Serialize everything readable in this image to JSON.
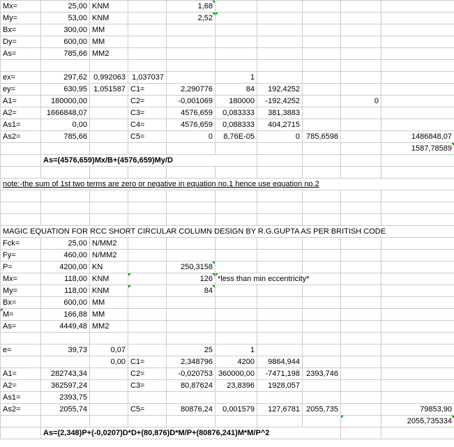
{
  "r1": {
    "a": "Mx=",
    "b": "25,00",
    "c": "KNM",
    "e": "1,68"
  },
  "r2": {
    "a": "My=",
    "b": "53,00",
    "c": "KNM",
    "e": "2,52"
  },
  "r3": {
    "a": "Bx=",
    "b": "300,00",
    "c": "MM"
  },
  "r4": {
    "a": "Dy=",
    "b": "600,00",
    "c": "MM"
  },
  "r5": {
    "a": "As=",
    "b": "785,66",
    "c": "MM2"
  },
  "r7": {
    "a": "ex=",
    "b": "297,62",
    "c": "0,992063",
    "d": "1,037037",
    "f": "1"
  },
  "r8": {
    "a": "ey=",
    "b": "630,95",
    "c": "1,051587",
    "d": "C1=",
    "e": "2,290776",
    "f": "84",
    "g": "192,4252"
  },
  "r9": {
    "a": "A1=",
    "b": "180000,00",
    "d": "C2=",
    "e": "-0,001069",
    "f": "180000",
    "g": "-192,4252",
    "i": "0"
  },
  "r10": {
    "a": "A2=",
    "b": "1666848,07",
    "d": "C3=",
    "e": "4576,659",
    "f": "0,083333",
    "g": "381,3883"
  },
  "r11": {
    "a": "As1=",
    "b": "0,00",
    "d": "C4=",
    "e": "4576,659",
    "f": "0,088333",
    "g": "404,2715"
  },
  "r12": {
    "a": "As2=",
    "b": "785,66",
    "d": "C5=",
    "e": "0",
    "f": "8,76E-05",
    "g": "0",
    "h": "785,6598",
    "j": "1486848,07"
  },
  "r13": {
    "j": "1587,78589"
  },
  "r14": {
    "formula": "As=(4576,659)Mx/B+(4576,659)My/D"
  },
  "r16": {
    "note": "note:-the sum of 1st two terms are zero or negative in equation no.1 hence use equation no.2"
  },
  "r20": {
    "title": "MAGIC EQUATION FOR RCC SHORT CIRCULAR COLUMN DESIGN BY R.G.GUPTA AS PER BRITISH CODE"
  },
  "r21": {
    "a": "Fck=",
    "b": "25,00",
    "c": "N/MM2"
  },
  "r22": {
    "a": "Fy=",
    "b": "460,00",
    "c": "N/MM2"
  },
  "r23": {
    "a": "P=",
    "b": "4200,00",
    "c": "KN",
    "e": "250,3158"
  },
  "r24": {
    "a": "Mx=",
    "b": "118,00",
    "c": "KNM",
    "e": "126",
    "f": "*less than min eccentricity*"
  },
  "r25": {
    "a": "My=",
    "b": "118,00",
    "c": "KNM",
    "e": "84"
  },
  "r26": {
    "a": "Bx=",
    "b": "600,00",
    "c": "MM"
  },
  "r27": {
    "a": "M=",
    "b": "166,88",
    "c": "MM"
  },
  "r28": {
    "a": "As=",
    "b": "4449,48",
    "c": "MM2"
  },
  "r30": {
    "a": "e=",
    "b": "39,73",
    "c": "0,07",
    "e": "25",
    "f": "1"
  },
  "r31": {
    "c": "0,00",
    "d": "C1=",
    "e": "2,348796",
    "f": "4200",
    "g": "9864,944"
  },
  "r32": {
    "a": "A1=",
    "b": "282743,34",
    "d": "C2=",
    "e": "-0,020753",
    "f": "360000,00",
    "g": "-7471,198",
    "h": "2393,746"
  },
  "r33": {
    "a": "A2=",
    "b": "362597,24",
    "d": "C3=",
    "e": "80,87624",
    "f": "23,8396",
    "g": "1928,057"
  },
  "r34": {
    "a": "As1=",
    "b": "2393,75"
  },
  "r35": {
    "a": "As2=",
    "b": "2055,74",
    "d": "C5=",
    "e": "80876,24",
    "f": "0,001579",
    "g": "127,6781",
    "h": "2055,735",
    "j": "79853,90"
  },
  "r36": {
    "j": "2055,735334"
  },
  "r37": {
    "formula": "As=(2,348)P+(-0,0207)D*D+(80,876)D*M/P+(80876,241)M*M/P^2"
  }
}
